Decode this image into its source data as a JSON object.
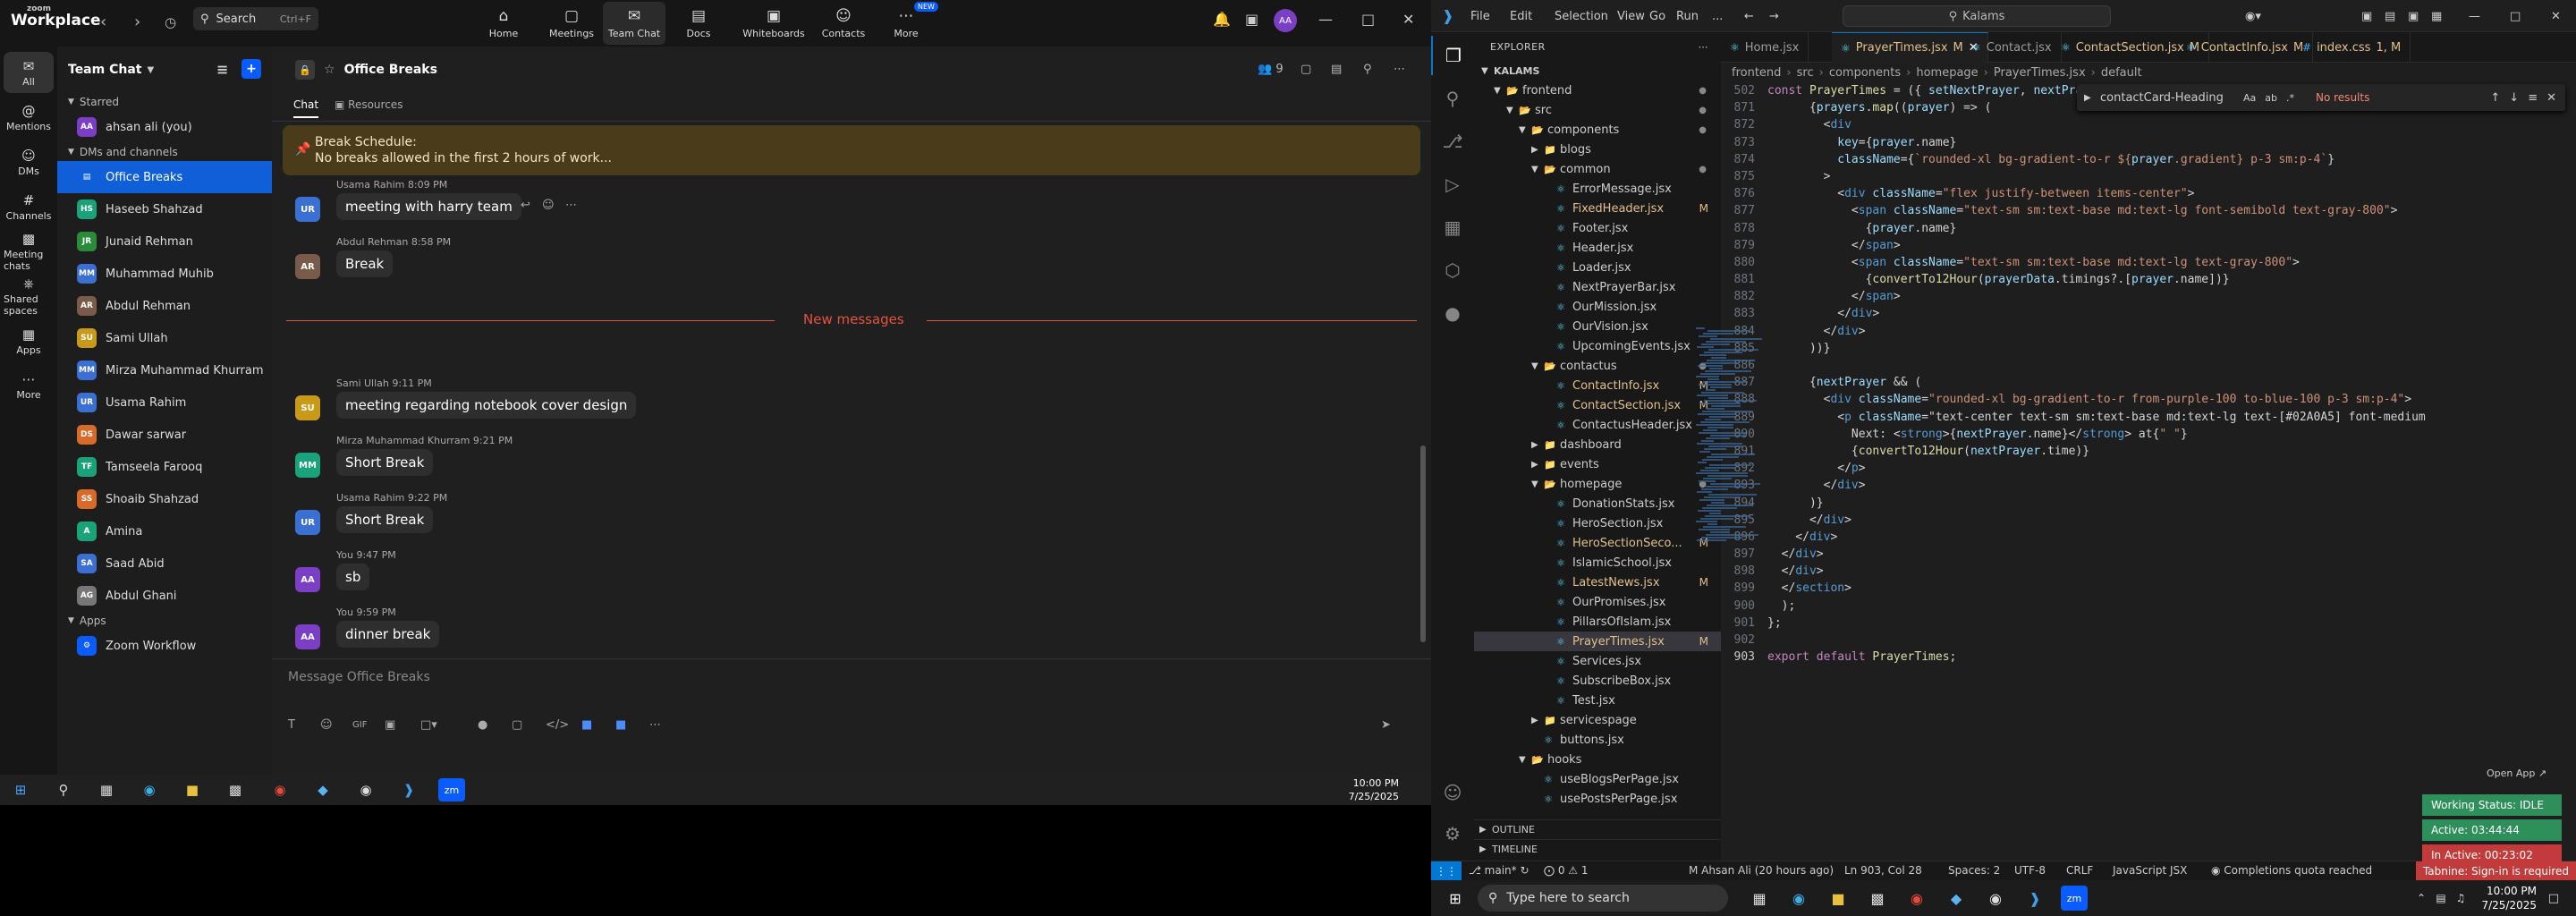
{
  "zoom": {
    "logo_line1": "zoom",
    "logo_line2": "Workplace",
    "search_label": "Search",
    "search_shortcut": "Ctrl+F",
    "topnav": [
      {
        "label": "Home",
        "icon": "home-icon"
      },
      {
        "label": "Meetings",
        "icon": "video-camera-icon"
      },
      {
        "label": "Team Chat",
        "icon": "chat-icon"
      },
      {
        "label": "Docs",
        "icon": "document-icon"
      },
      {
        "label": "Whiteboards",
        "icon": "whiteboard-icon"
      },
      {
        "label": "Contacts",
        "icon": "contacts-icon"
      },
      {
        "label": "More",
        "icon": "more-icon"
      }
    ],
    "new_badge": "NEW",
    "user_initials": "AA",
    "rail": [
      {
        "label": "All",
        "icon": "chat-bubble-icon"
      },
      {
        "label": "Mentions",
        "icon": "at-icon"
      },
      {
        "label": "DMs",
        "icon": "people-icon"
      },
      {
        "label": "Channels",
        "icon": "channels-icon"
      },
      {
        "label": "Meeting chats",
        "icon": "meeting-chat-icon"
      },
      {
        "label": "Shared spaces",
        "icon": "shared-spaces-icon"
      },
      {
        "label": "Apps",
        "icon": "apps-icon"
      },
      {
        "label": "More",
        "icon": "more-icon"
      }
    ],
    "sidebar": {
      "title": "Team Chat",
      "starred_label": "Starred",
      "self_item": {
        "initials": "AA",
        "name": "ahsan ali (you)"
      },
      "dms_label": "DMs and channels",
      "items": [
        {
          "initials": "",
          "name": "Office Breaks",
          "color": "#0e5fd8"
        },
        {
          "initials": "HS",
          "name": "Haseeb Shahzad",
          "color": "#1aa37a"
        },
        {
          "initials": "JR",
          "name": "Junaid Rehman",
          "color": "#2a8c3a"
        },
        {
          "initials": "MM",
          "name": "Muhammad Muhib",
          "color": "#3b6fd1"
        },
        {
          "initials": "AR",
          "name": "Abdul Rehman",
          "color": "#7a5a4a"
        },
        {
          "initials": "SU",
          "name": "Sami Ullah",
          "color": "#c99a1a"
        },
        {
          "initials": "MM",
          "name": "Mirza Muhammad Khurram",
          "color": "#3b6fd1"
        },
        {
          "initials": "UR",
          "name": "Usama Rahim",
          "color": "#3b6fd1"
        },
        {
          "initials": "DS",
          "name": "Dawar sarwar",
          "color": "#d86a2a"
        },
        {
          "initials": "TF",
          "name": "Tamseela Farooq",
          "color": "#1aa37a"
        },
        {
          "initials": "SS",
          "name": "Shoaib Shahzad",
          "color": "#d86a2a"
        },
        {
          "initials": "A",
          "name": "Amina",
          "color": "#1aa37a"
        },
        {
          "initials": "SA",
          "name": "Saad Abid",
          "color": "#3b6fd1"
        },
        {
          "initials": "AG",
          "name": "Abdul Ghani",
          "color": "#777777"
        }
      ],
      "apps_label": "Apps",
      "app_item": "Zoom Workflow"
    },
    "chat": {
      "channel": "Office Breaks",
      "member_count": "9",
      "tabs": [
        "Chat",
        "Resources"
      ],
      "pinned_title": "Break Schedule:",
      "pinned_text": "No breaks allowed in the first 2 hours of work...",
      "messages": [
        {
          "initials": "UR",
          "color": "#3b6fd1",
          "sender": "Usama Rahim",
          "time": "8:09 PM",
          "text": "meeting with harry team"
        },
        {
          "initials": "AR",
          "color": "#7a5a4a",
          "sender": "Abdul Rehman",
          "time": "8:58 PM",
          "text": "Break"
        },
        {
          "initials": "SU",
          "color": "#c99a1a",
          "sender": "Sami Ullah",
          "time": "9:11 PM",
          "text": "meeting regarding notebook cover design"
        },
        {
          "initials": "MM",
          "color": "#1aa37a",
          "sender": "Mirza Muhammad Khurram",
          "time": "9:21 PM",
          "text": "Short Break"
        },
        {
          "initials": "UR",
          "color": "#3b6fd1",
          "sender": "Usama Rahim",
          "time": "9:22 PM",
          "text": "Short Break"
        },
        {
          "initials": "AA",
          "color": "#7a3fc4",
          "sender": "You",
          "time": "9:47 PM",
          "text": "sb"
        },
        {
          "initials": "AA",
          "color": "#7a3fc4",
          "sender": "You",
          "time": "9:59 PM",
          "text": "dinner break"
        }
      ],
      "new_messages_label": "New messages",
      "compose_placeholder": "Message Office Breaks"
    },
    "taskbar_time": "10:00 PM",
    "taskbar_date": "7/25/2025"
  },
  "vscode": {
    "menu": [
      "File",
      "Edit",
      "Selection",
      "View",
      "Go",
      "Run",
      "..."
    ],
    "command_center": "Kalams",
    "explorer_label": "EXPLORER",
    "tree": [
      {
        "name": "KALAMS",
        "depth": 0,
        "type": "root"
      },
      {
        "name": "frontend",
        "depth": 1,
        "type": "folder-open",
        "dot": true
      },
      {
        "name": "src",
        "depth": 2,
        "type": "folder-open",
        "dot": true
      },
      {
        "name": "components",
        "depth": 3,
        "type": "folder-open",
        "dot": true
      },
      {
        "name": "blogs",
        "depth": 4,
        "type": "folder"
      },
      {
        "name": "common",
        "depth": 4,
        "type": "folder-open",
        "dot": true
      },
      {
        "name": "ErrorMessage.jsx",
        "depth": 5,
        "type": "file"
      },
      {
        "name": "FixedHeader.jsx",
        "depth": 5,
        "type": "file",
        "m": "M"
      },
      {
        "name": "Footer.jsx",
        "depth": 5,
        "type": "file"
      },
      {
        "name": "Header.jsx",
        "depth": 5,
        "type": "file"
      },
      {
        "name": "Loader.jsx",
        "depth": 5,
        "type": "file"
      },
      {
        "name": "NextPrayerBar.jsx",
        "depth": 5,
        "type": "file"
      },
      {
        "name": "OurMission.jsx",
        "depth": 5,
        "type": "file"
      },
      {
        "name": "OurVision.jsx",
        "depth": 5,
        "type": "file"
      },
      {
        "name": "UpcomingEvents.jsx",
        "depth": 5,
        "type": "file"
      },
      {
        "name": "contactus",
        "depth": 4,
        "type": "folder-open",
        "dot": true
      },
      {
        "name": "ContactInfo.jsx",
        "depth": 5,
        "type": "file",
        "m": "M"
      },
      {
        "name": "ContactSection.jsx",
        "depth": 5,
        "type": "file",
        "m": "M"
      },
      {
        "name": "ContactusHeader.jsx",
        "depth": 5,
        "type": "file"
      },
      {
        "name": "dashboard",
        "depth": 4,
        "type": "folder"
      },
      {
        "name": "events",
        "depth": 4,
        "type": "folder"
      },
      {
        "name": "homepage",
        "depth": 4,
        "type": "folder-open",
        "dot": true
      },
      {
        "name": "DonationStats.jsx",
        "depth": 5,
        "type": "file"
      },
      {
        "name": "HeroSection.jsx",
        "depth": 5,
        "type": "file"
      },
      {
        "name": "HeroSectionSeco...",
        "depth": 5,
        "type": "file",
        "m": "M"
      },
      {
        "name": "IslamicSchool.jsx",
        "depth": 5,
        "type": "file"
      },
      {
        "name": "LatestNews.jsx",
        "depth": 5,
        "type": "file",
        "m": "M"
      },
      {
        "name": "OurPromises.jsx",
        "depth": 5,
        "type": "file"
      },
      {
        "name": "PillarsOfIslam.jsx",
        "depth": 5,
        "type": "file"
      },
      {
        "name": "PrayerTimes.jsx",
        "depth": 5,
        "type": "file",
        "m": "M",
        "selected": true
      },
      {
        "name": "Services.jsx",
        "depth": 5,
        "type": "file"
      },
      {
        "name": "SubscribeBox.jsx",
        "depth": 5,
        "type": "file"
      },
      {
        "name": "Test.jsx",
        "depth": 5,
        "type": "file"
      },
      {
        "name": "servicespage",
        "depth": 4,
        "type": "folder"
      },
      {
        "name": "buttons.jsx",
        "depth": 4,
        "type": "file"
      },
      {
        "name": "hooks",
        "depth": 3,
        "type": "folder-open"
      },
      {
        "name": "useBlogsPerPage.jsx",
        "depth": 4,
        "type": "file"
      },
      {
        "name": "usePostsPerPage.jsx",
        "depth": 4,
        "type": "file"
      }
    ],
    "outline_label": "OUTLINE",
    "timeline_label": "TIMELINE",
    "tabs": [
      {
        "name": "Home.jsx",
        "m": ""
      },
      {
        "name": "PrayerTimes.jsx",
        "m": "M",
        "active": true
      },
      {
        "name": "Contact.jsx",
        "m": ""
      },
      {
        "name": "ContactSection.jsx",
        "m": "M"
      },
      {
        "name": "ContactInfo.jsx",
        "m": "M"
      },
      {
        "name": "index.css",
        "m": "1, M"
      }
    ],
    "breadcrumb": [
      "frontend",
      "src",
      "components",
      "homepage",
      "PrayerTimes.jsx",
      "default"
    ],
    "find": {
      "query": "contactCard-Heading",
      "result": "No results"
    },
    "code": [
      {
        "n": "502",
        "t": "const PrayerTimes = ({ setNextPrayer, nextPrayer"
      },
      {
        "n": "871",
        "t": "      {prayers.map((prayer) => ("
      },
      {
        "n": "872",
        "t": "        <div"
      },
      {
        "n": "873",
        "t": "          key={prayer.name}"
      },
      {
        "n": "874",
        "t": "          className={`rounded-xl bg-gradient-to-r ${prayer.gradient} p-3 sm:p-4`}"
      },
      {
        "n": "875",
        "t": "        >"
      },
      {
        "n": "876",
        "t": "          <div className=\"flex justify-between items-center\">"
      },
      {
        "n": "877",
        "t": "            <span className=\"text-sm sm:text-base md:text-lg font-semibold text-gray-800\">"
      },
      {
        "n": "878",
        "t": "              {prayer.name}"
      },
      {
        "n": "879",
        "t": "            </span>"
      },
      {
        "n": "880",
        "t": "            <span className=\"text-sm sm:text-base md:text-lg text-gray-800\">"
      },
      {
        "n": "881",
        "t": "              {convertTo12Hour(prayerData.timings?.[prayer.name])}"
      },
      {
        "n": "882",
        "t": "            </span>"
      },
      {
        "n": "883",
        "t": "          </div>"
      },
      {
        "n": "884",
        "t": "        </div>"
      },
      {
        "n": "885",
        "t": "      ))}"
      },
      {
        "n": "886",
        "t": ""
      },
      {
        "n": "887",
        "t": "      {nextPrayer && ("
      },
      {
        "n": "888",
        "t": "        <div className=\"rounded-xl bg-gradient-to-r from-purple-100 to-blue-100 p-3 sm:p-4\">"
      },
      {
        "n": "889",
        "t": "          <p className=\"text-center text-sm sm:text-base md:text-lg text-[#02A0A5] font-medium"
      },
      {
        "n": "890",
        "t": "            Next: <strong>{nextPrayer.name}</strong> at{\" \"}"
      },
      {
        "n": "891",
        "t": "            {convertTo12Hour(nextPrayer.time)}"
      },
      {
        "n": "892",
        "t": "          </p>"
      },
      {
        "n": "893",
        "t": "        </div>"
      },
      {
        "n": "894",
        "t": "      )}"
      },
      {
        "n": "895",
        "t": "      </div>"
      },
      {
        "n": "896",
        "t": "    </div>"
      },
      {
        "n": "897",
        "t": "  </div>"
      },
      {
        "n": "898",
        "t": "  </div>"
      },
      {
        "n": "899",
        "t": "  </section>"
      },
      {
        "n": "900",
        "t": "  );"
      },
      {
        "n": "901",
        "t": "};"
      },
      {
        "n": "902",
        "t": ""
      },
      {
        "n": "903",
        "t": "export default PrayerTimes;"
      }
    ],
    "status": {
      "branch": "main*",
      "problems": "0 ⚠ 1",
      "blame": "M Ahsan Ali (20 hours ago)",
      "position": "Ln 903, Col 28",
      "spaces": "Spaces: 2",
      "encoding": "UTF-8",
      "eol": "CRLF",
      "language": "JavaScript JSX",
      "copilot": "Completions quota reached",
      "tabnine": "Tabnine: Sign-in is required"
    },
    "open_app": "Open App ↗",
    "working_status": [
      {
        "label": "Working Status: IDLE",
        "color": "#2f8f5a"
      },
      {
        "label": "Active: 03:44:44",
        "color": "#2f8f5a"
      },
      {
        "label": "In Active: 00:23:02",
        "color": "#c23b3b"
      }
    ]
  },
  "windows": {
    "search_placeholder": "Type here to search",
    "time": "10:00 PM",
    "date": "7/25/2025"
  }
}
